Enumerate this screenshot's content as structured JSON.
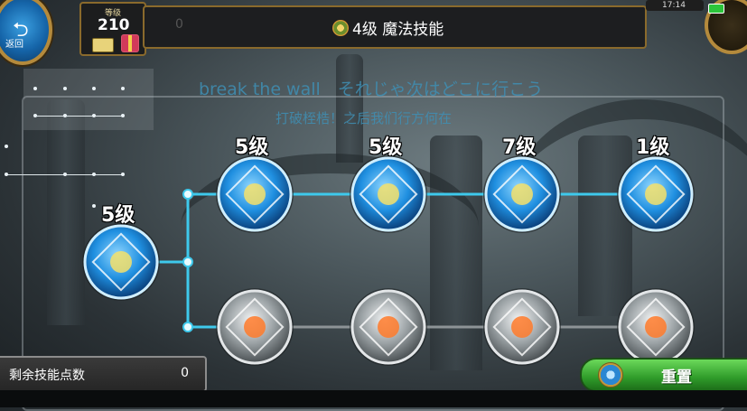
{
  "top_bar": {
    "back_label": "返回",
    "back_arrow": "⮌",
    "level_caption": "等级",
    "level_value": "210",
    "header_zero": "0",
    "title": "4级 魔法技能",
    "clock": "17:14"
  },
  "lyrics": {
    "line1": "break the wall　それじゃ次はどこに行こう",
    "line2": "打破桎梏！之后我们行方何在"
  },
  "skills": {
    "root": {
      "level": "5级",
      "icon": "arrow-spread-icon",
      "unlocked": true
    },
    "top_row": [
      {
        "level": "5级",
        "icon": "piercing-arrow-icon",
        "unlocked": true
      },
      {
        "level": "5级",
        "icon": "triple-arrow-icon",
        "unlocked": true
      },
      {
        "level": "7级",
        "icon": "summon-figure-icon",
        "unlocked": true
      },
      {
        "level": "1级",
        "icon": "fire-dome-icon",
        "unlocked": true
      }
    ],
    "bottom_row": [
      {
        "icon": "fire-pillar-icon",
        "unlocked": false
      },
      {
        "icon": "flame-burst-icon",
        "unlocked": false
      },
      {
        "icon": "wind-vortex-icon",
        "unlocked": false
      },
      {
        "icon": "radiant-blast-icon",
        "unlocked": false
      }
    ],
    "colors": {
      "connector_active": "#3ec9ec",
      "connector_locked": "#8d9396",
      "node_active": "#1f8fe0",
      "node_locked": "#9aa1a4"
    }
  },
  "bottom": {
    "points_label": "剩余技能点数",
    "points_value": "0",
    "reset_label": "重置"
  }
}
